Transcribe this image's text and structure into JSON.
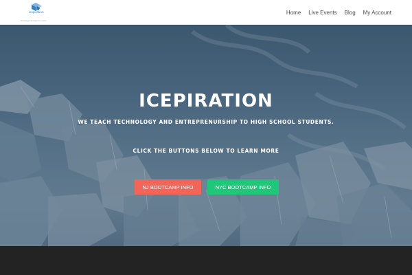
{
  "header": {
    "logo_text": "icepiration",
    "logo_tagline": "technology that taught me to learn",
    "nav": {
      "home": "Home",
      "live_events": "Live Events",
      "blog": "Blog",
      "my_account": "My Account"
    }
  },
  "hero": {
    "title": "ICEPIRATION",
    "subtitle": "WE TEACH TECHNOLOGY AND ENTREPRENURSHIP TO HIGH SCHOOL STUDENTS.",
    "cta_text": "CLICK THE BUTTONS BELOW TO LEARN MORE",
    "buttons": {
      "nj": "NJ BOOTCAMP INFO",
      "nyc": "NYC BOOTCAMP INFO"
    }
  },
  "colors": {
    "nj_button": "#f2665a",
    "nyc_button": "#1fc779",
    "footer": "#232323",
    "nav_text": "#4a4a4a"
  },
  "icons": {
    "logo": "ice-cube-logo-icon"
  }
}
